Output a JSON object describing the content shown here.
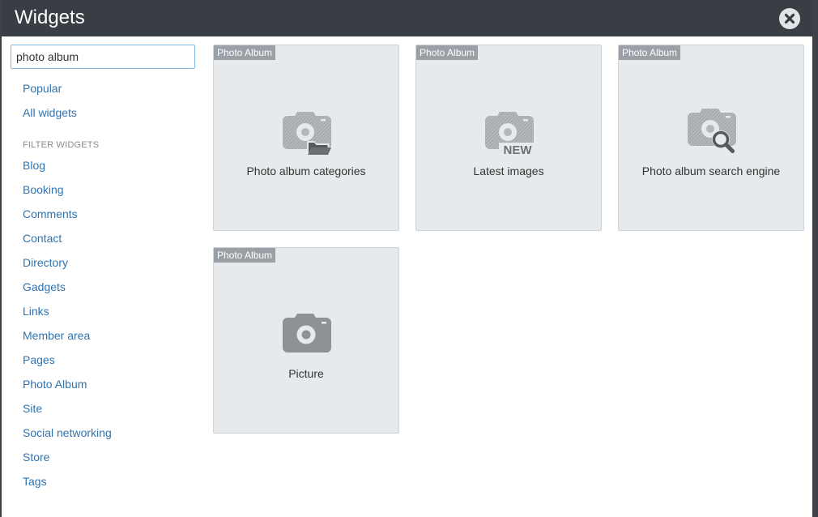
{
  "dialog": {
    "title": "Widgets"
  },
  "search": {
    "value": "photo album",
    "placeholder": ""
  },
  "sidebar": {
    "top_links": [
      "Popular",
      "All widgets"
    ],
    "filter_heading": "FILTER WIDGETS",
    "categories": [
      "Blog",
      "Booking",
      "Comments",
      "Contact",
      "Directory",
      "Gadgets",
      "Links",
      "Member area",
      "Pages",
      "Photo Album",
      "Site",
      "Social networking",
      "Store",
      "Tags"
    ]
  },
  "widgets": [
    {
      "badge": "Photo Album",
      "label": "Photo album categories",
      "icon": "camera-folder-icon"
    },
    {
      "badge": "Photo Album",
      "label": "Latest images",
      "icon": "camera-new-icon",
      "icon_text": "NEW"
    },
    {
      "badge": "Photo Album",
      "label": "Photo album search engine",
      "icon": "camera-search-icon"
    },
    {
      "badge": "Photo Album",
      "label": "Picture",
      "icon": "camera-icon"
    }
  ],
  "colors": {
    "header_bg": "#393e45",
    "link": "#2f74b1",
    "card_bg": "#e7eaec",
    "badge_bg": "#9aa0a5",
    "icon_gray": "#9fa3a7"
  }
}
